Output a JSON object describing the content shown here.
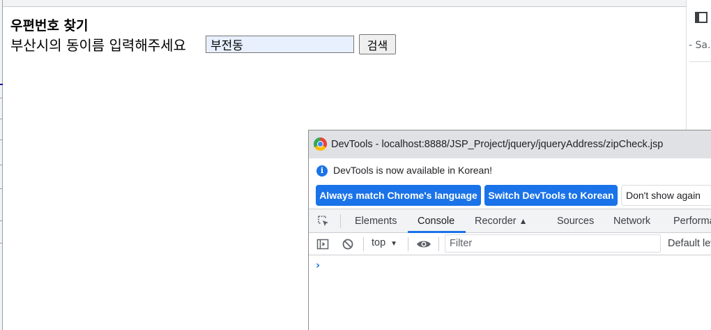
{
  "page": {
    "title": "우편번호 찾기",
    "prompt": "부산시의 동이름 입력해주세요",
    "dong_value": "부전동",
    "search_label": "검색"
  },
  "background": {
    "right_snippet": "- Sa..."
  },
  "devtools": {
    "window_title": "DevTools - localhost:8888/JSP_Project/jquery/jqueryAddress/zipCheck.jsp",
    "info_message": "DevTools is now available in Korean!",
    "btn_match": "Always match Chrome's language",
    "btn_switch": "Switch DevTools to Korean",
    "btn_dont": "Don't show again",
    "tabs": [
      "Elements",
      "Console",
      "Recorder",
      "Sources",
      "Network",
      "Performance"
    ],
    "active_tab": "Console",
    "context": "top",
    "filter_placeholder": "Filter",
    "levels": "Default levels",
    "prompt_symbol": "›"
  },
  "colors": {
    "accent": "#1a73e8",
    "input_autofill_bg": "#e8f0fe"
  }
}
